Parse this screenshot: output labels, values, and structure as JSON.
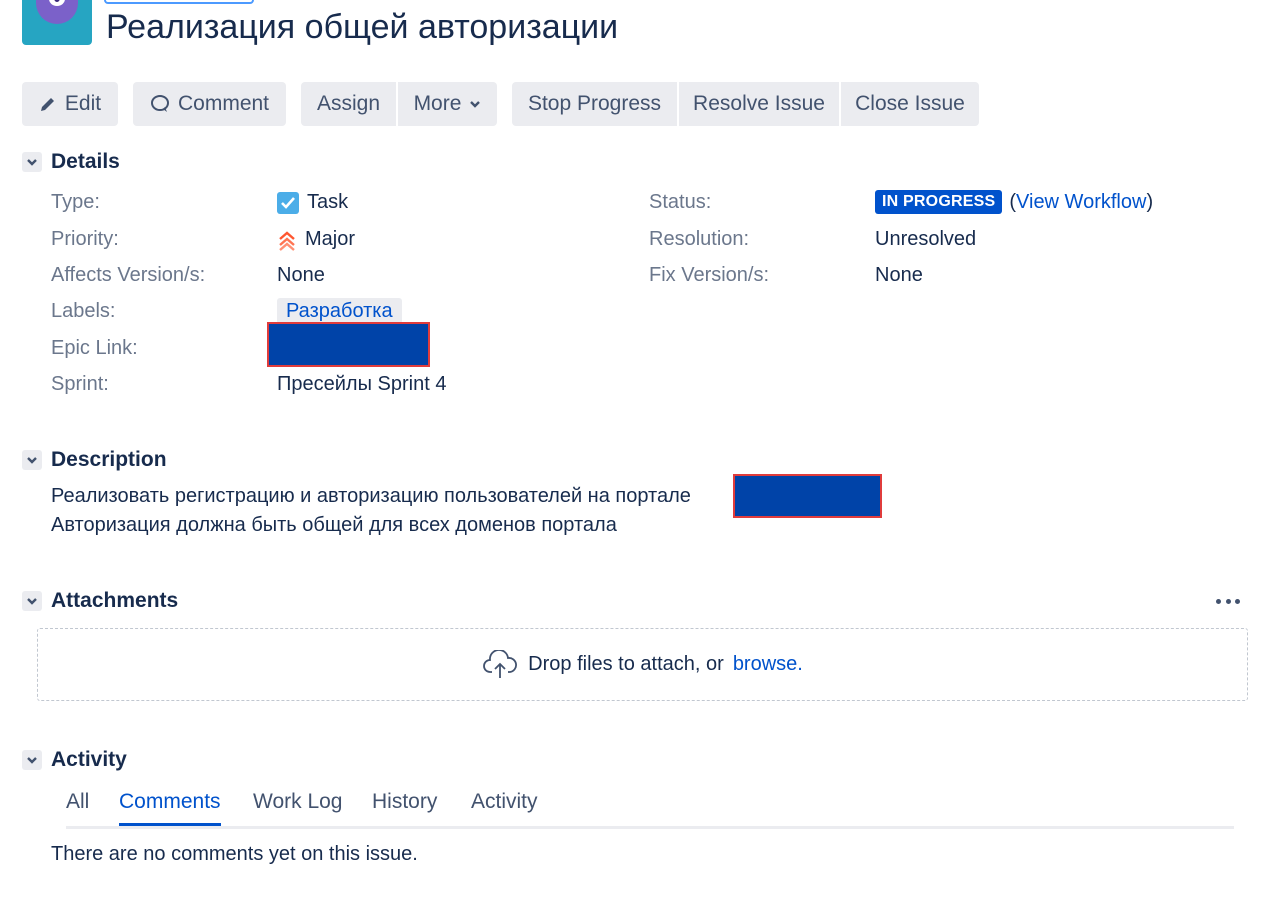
{
  "issue": {
    "title": "Реализация общей авторизации"
  },
  "toolbar": {
    "edit": "Edit",
    "comment": "Comment",
    "assign": "Assign",
    "more": "More",
    "stop_progress": "Stop Progress",
    "resolve_issue": "Resolve Issue",
    "close_issue": "Close Issue"
  },
  "details": {
    "heading": "Details",
    "type_label": "Type:",
    "type_value": "Task",
    "priority_label": "Priority:",
    "priority_value": "Major",
    "affects_label": "Affects Version/s:",
    "affects_value": "None",
    "labels_label": "Labels:",
    "labels_value": "Разработка",
    "epic_label": "Epic Link:",
    "sprint_label": "Sprint:",
    "sprint_value": "Пресейлы Sprint 4",
    "status_label": "Status:",
    "status_value": "IN PROGRESS",
    "view_workflow": "View Workflow",
    "resolution_label": "Resolution:",
    "resolution_value": "Unresolved",
    "fix_label": "Fix Version/s:",
    "fix_value": "None"
  },
  "description": {
    "heading": "Description",
    "line1": "Реализовать регистрацию и авторизацию пользователей на портале",
    "line2": "Авторизация должна быть общей для всех доменов портала"
  },
  "attachments": {
    "heading": "Attachments",
    "drop_text": "Drop files to attach, or",
    "browse": "browse."
  },
  "activity": {
    "heading": "Activity",
    "tabs": [
      "All",
      "Comments",
      "Work Log",
      "History",
      "Activity"
    ],
    "active_tab": "Comments",
    "empty": "There are no comments yet on this issue."
  },
  "colors": {
    "link": "#0052cc",
    "status_lozenge": "#0052cc",
    "priority_major": "#ff5630",
    "task_icon": "#4bade8",
    "redaction_fill": "#0043a8",
    "redaction_border": "#e03c3c"
  },
  "icons": {
    "edit": "pencil-icon",
    "comment": "speech-bubble-icon",
    "more": "chevron-down-icon",
    "section_toggle": "chevron-down-icon",
    "type": "checkbox-task-icon",
    "priority": "double-chevron-up-icon",
    "upload": "cloud-upload-icon",
    "attachments_more": "ellipsis-icon"
  }
}
